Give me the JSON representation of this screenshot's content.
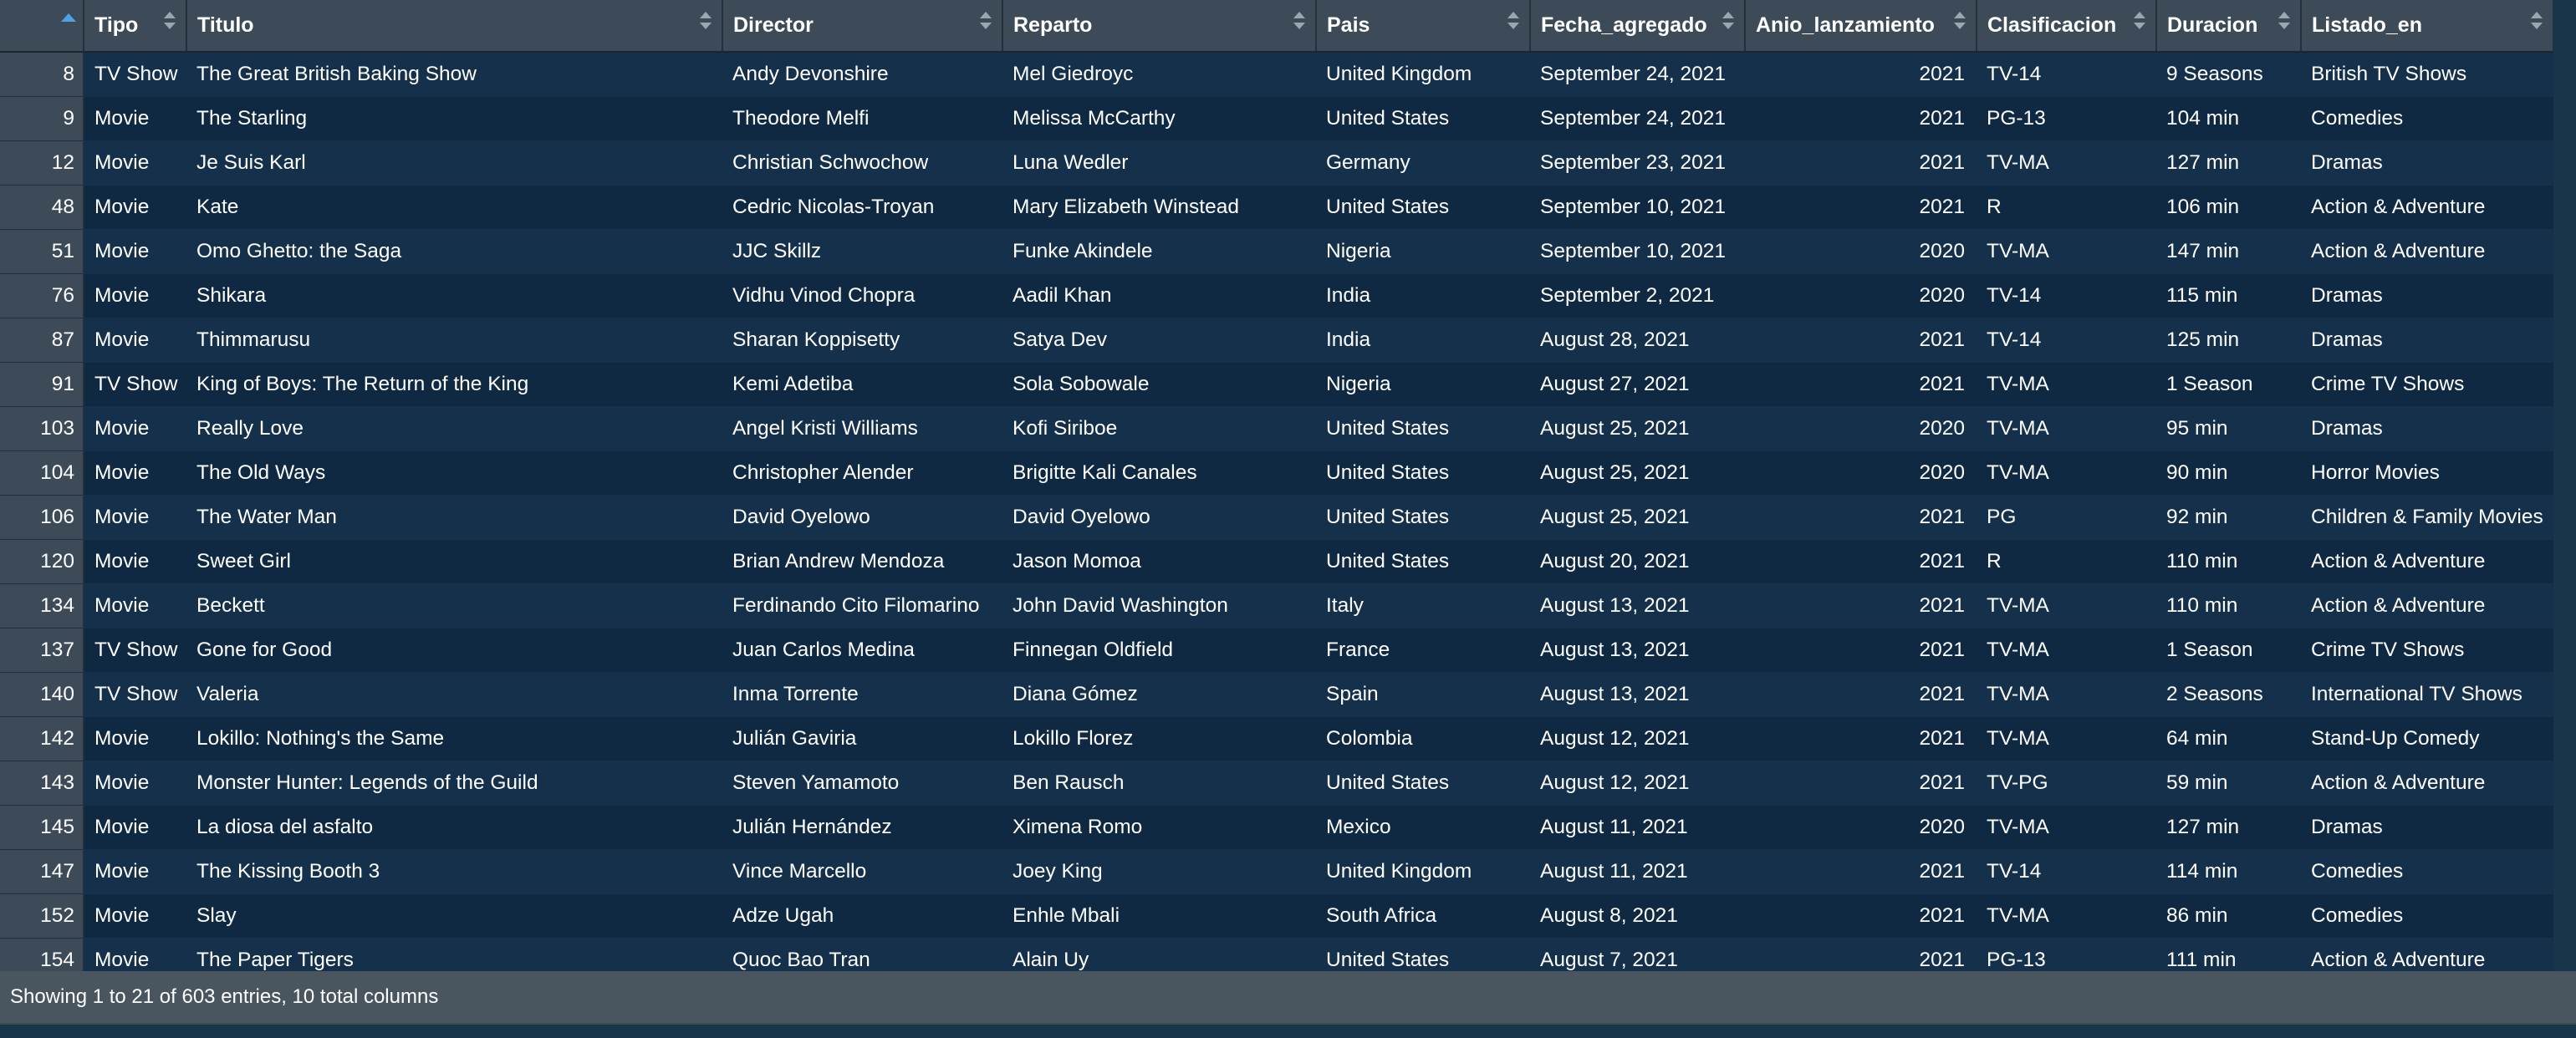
{
  "table": {
    "columns": [
      {
        "key": "tipo",
        "label": "Tipo"
      },
      {
        "key": "titulo",
        "label": "Titulo"
      },
      {
        "key": "director",
        "label": "Director"
      },
      {
        "key": "reparto",
        "label": "Reparto"
      },
      {
        "key": "pais",
        "label": "Pais"
      },
      {
        "key": "fecha",
        "label": "Fecha_agregado"
      },
      {
        "key": "anio",
        "label": "Anio_lanzamiento"
      },
      {
        "key": "clasificacion",
        "label": "Clasificacion"
      },
      {
        "key": "duracion",
        "label": "Duracion"
      },
      {
        "key": "listado",
        "label": "Listado_en"
      }
    ],
    "sorted_column": "index",
    "sort_direction": "ascending",
    "rows": [
      {
        "idx": "8",
        "tipo": "TV Show",
        "titulo": "The Great British Baking Show",
        "director": "Andy Devonshire",
        "reparto": "Mel Giedroyc",
        "pais": "United Kingdom",
        "fecha": "September 24, 2021",
        "anio": "2021",
        "clasificacion": "TV-14",
        "duracion": "9 Seasons",
        "listado": "British TV Shows"
      },
      {
        "idx": "9",
        "tipo": "Movie",
        "titulo": "The Starling",
        "director": "Theodore Melfi",
        "reparto": "Melissa McCarthy",
        "pais": "United States",
        "fecha": "September 24, 2021",
        "anio": "2021",
        "clasificacion": "PG-13",
        "duracion": "104 min",
        "listado": "Comedies"
      },
      {
        "idx": "12",
        "tipo": "Movie",
        "titulo": "Je Suis Karl",
        "director": "Christian Schwochow",
        "reparto": "Luna Wedler",
        "pais": "Germany",
        "fecha": "September 23, 2021",
        "anio": "2021",
        "clasificacion": "TV-MA",
        "duracion": "127 min",
        "listado": "Dramas"
      },
      {
        "idx": "48",
        "tipo": "Movie",
        "titulo": "Kate",
        "director": "Cedric Nicolas-Troyan",
        "reparto": "Mary Elizabeth Winstead",
        "pais": "United States",
        "fecha": "September 10, 2021",
        "anio": "2021",
        "clasificacion": "R",
        "duracion": "106 min",
        "listado": "Action & Adventure"
      },
      {
        "idx": "51",
        "tipo": "Movie",
        "titulo": "Omo Ghetto: the Saga",
        "director": "JJC Skillz",
        "reparto": "Funke Akindele",
        "pais": "Nigeria",
        "fecha": "September 10, 2021",
        "anio": "2020",
        "clasificacion": "TV-MA",
        "duracion": "147 min",
        "listado": "Action & Adventure"
      },
      {
        "idx": "76",
        "tipo": "Movie",
        "titulo": "Shikara",
        "director": "Vidhu Vinod Chopra",
        "reparto": "Aadil Khan",
        "pais": "India",
        "fecha": "September 2, 2021",
        "anio": "2020",
        "clasificacion": "TV-14",
        "duracion": "115 min",
        "listado": "Dramas"
      },
      {
        "idx": "87",
        "tipo": "Movie",
        "titulo": "Thimmarusu",
        "director": "Sharan Koppisetty",
        "reparto": "Satya Dev",
        "pais": "India",
        "fecha": "August 28, 2021",
        "anio": "2021",
        "clasificacion": "TV-14",
        "duracion": "125 min",
        "listado": "Dramas"
      },
      {
        "idx": "91",
        "tipo": "TV Show",
        "titulo": "King of Boys: The Return of the King",
        "director": "Kemi Adetiba",
        "reparto": "Sola Sobowale",
        "pais": "Nigeria",
        "fecha": "August 27, 2021",
        "anio": "2021",
        "clasificacion": "TV-MA",
        "duracion": "1 Season",
        "listado": "Crime TV Shows"
      },
      {
        "idx": "103",
        "tipo": "Movie",
        "titulo": "Really Love",
        "director": "Angel Kristi Williams",
        "reparto": "Kofi Siriboe",
        "pais": "United States",
        "fecha": "August 25, 2021",
        "anio": "2020",
        "clasificacion": "TV-MA",
        "duracion": "95 min",
        "listado": "Dramas"
      },
      {
        "idx": "104",
        "tipo": "Movie",
        "titulo": "The Old Ways",
        "director": "Christopher Alender",
        "reparto": "Brigitte Kali Canales",
        "pais": "United States",
        "fecha": "August 25, 2021",
        "anio": "2020",
        "clasificacion": "TV-MA",
        "duracion": "90 min",
        "listado": "Horror Movies"
      },
      {
        "idx": "106",
        "tipo": "Movie",
        "titulo": "The Water Man",
        "director": "David Oyelowo",
        "reparto": "David Oyelowo",
        "pais": "United States",
        "fecha": "August 25, 2021",
        "anio": "2021",
        "clasificacion": "PG",
        "duracion": "92 min",
        "listado": "Children & Family Movies"
      },
      {
        "idx": "120",
        "tipo": "Movie",
        "titulo": "Sweet Girl",
        "director": "Brian Andrew Mendoza",
        "reparto": "Jason Momoa",
        "pais": "United States",
        "fecha": "August 20, 2021",
        "anio": "2021",
        "clasificacion": "R",
        "duracion": "110 min",
        "listado": "Action & Adventure"
      },
      {
        "idx": "134",
        "tipo": "Movie",
        "titulo": "Beckett",
        "director": "Ferdinando Cito Filomarino",
        "reparto": "John David Washington",
        "pais": "Italy",
        "fecha": "August 13, 2021",
        "anio": "2021",
        "clasificacion": "TV-MA",
        "duracion": "110 min",
        "listado": "Action & Adventure"
      },
      {
        "idx": "137",
        "tipo": "TV Show",
        "titulo": "Gone for Good",
        "director": "Juan Carlos Medina",
        "reparto": "Finnegan Oldfield",
        "pais": "France",
        "fecha": "August 13, 2021",
        "anio": "2021",
        "clasificacion": "TV-MA",
        "duracion": "1 Season",
        "listado": "Crime TV Shows"
      },
      {
        "idx": "140",
        "tipo": "TV Show",
        "titulo": "Valeria",
        "director": "Inma Torrente",
        "reparto": "Diana Gómez",
        "pais": "Spain",
        "fecha": "August 13, 2021",
        "anio": "2021",
        "clasificacion": "TV-MA",
        "duracion": "2 Seasons",
        "listado": "International TV Shows"
      },
      {
        "idx": "142",
        "tipo": "Movie",
        "titulo": "Lokillo: Nothing's the Same",
        "director": "Julián Gaviria",
        "reparto": "Lokillo Florez",
        "pais": "Colombia",
        "fecha": "August 12, 2021",
        "anio": "2021",
        "clasificacion": "TV-MA",
        "duracion": "64 min",
        "listado": "Stand-Up Comedy"
      },
      {
        "idx": "143",
        "tipo": "Movie",
        "titulo": "Monster Hunter: Legends of the Guild",
        "director": "Steven Yamamoto",
        "reparto": "Ben Rausch",
        "pais": "United States",
        "fecha": "August 12, 2021",
        "anio": "2021",
        "clasificacion": "TV-PG",
        "duracion": "59 min",
        "listado": "Action & Adventure"
      },
      {
        "idx": "145",
        "tipo": "Movie",
        "titulo": "La diosa del asfalto",
        "director": "Julián Hernández",
        "reparto": "Ximena Romo",
        "pais": "Mexico",
        "fecha": "August 11, 2021",
        "anio": "2020",
        "clasificacion": "TV-MA",
        "duracion": "127 min",
        "listado": "Dramas"
      },
      {
        "idx": "147",
        "tipo": "Movie",
        "titulo": "The Kissing Booth 3",
        "director": "Vince Marcello",
        "reparto": "Joey King",
        "pais": "United Kingdom",
        "fecha": "August 11, 2021",
        "anio": "2021",
        "clasificacion": "TV-14",
        "duracion": "114 min",
        "listado": "Comedies"
      },
      {
        "idx": "152",
        "tipo": "Movie",
        "titulo": "Slay",
        "director": "Adze Ugah",
        "reparto": "Enhle Mbali",
        "pais": "South Africa",
        "fecha": "August 8, 2021",
        "anio": "2021",
        "clasificacion": "TV-MA",
        "duracion": "86 min",
        "listado": "Comedies"
      },
      {
        "idx": "154",
        "tipo": "Movie",
        "titulo": "The Paper Tigers",
        "director": "Quoc Bao Tran",
        "reparto": "Alain Uy",
        "pais": "United States",
        "fecha": "August 7, 2021",
        "anio": "2021",
        "clasificacion": "PG-13",
        "duracion": "111 min",
        "listado": "Action & Adventure"
      }
    ]
  },
  "footer": {
    "text": "Showing 1 to 21 of 603 entries, 10 total columns"
  },
  "icons": {
    "sort_active": "sort-ascending-icon",
    "sort_inactive": "sort-both-icon"
  },
  "colors": {
    "background": "#193549",
    "header": "#3d4b58",
    "row_odd": "#15304a",
    "row_even": "#0f2942",
    "sort_active": "#4ea3e6"
  }
}
